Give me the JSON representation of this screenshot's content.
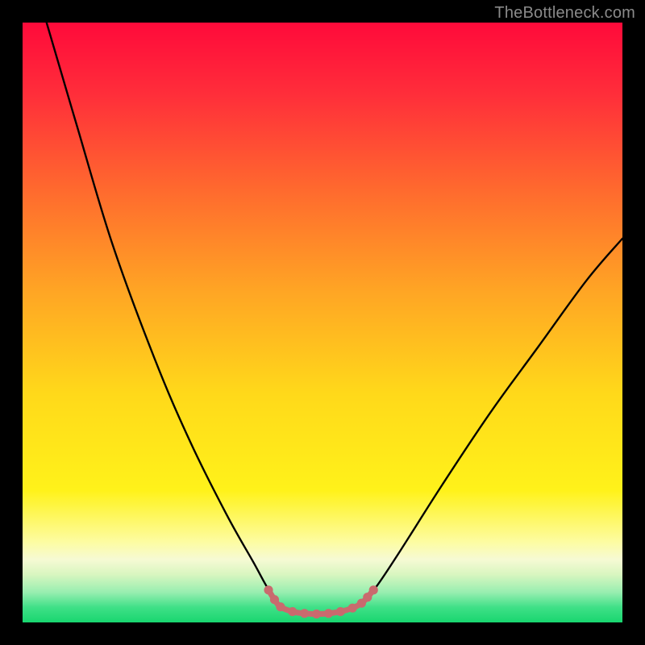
{
  "watermark": "TheBottleneck.com",
  "chart_data": {
    "type": "line",
    "title": "",
    "xlabel": "",
    "ylabel": "",
    "xlim": [
      0,
      100
    ],
    "ylim": [
      0,
      100
    ],
    "grid": false,
    "legend": false,
    "gradient_stops": [
      {
        "offset": 0.0,
        "color": "#ff0a3a"
      },
      {
        "offset": 0.12,
        "color": "#ff2e3a"
      },
      {
        "offset": 0.28,
        "color": "#ff6a2e"
      },
      {
        "offset": 0.45,
        "color": "#ffa624"
      },
      {
        "offset": 0.62,
        "color": "#ffd91a"
      },
      {
        "offset": 0.78,
        "color": "#fff21a"
      },
      {
        "offset": 0.865,
        "color": "#fdfca0"
      },
      {
        "offset": 0.895,
        "color": "#f6fad4"
      },
      {
        "offset": 0.92,
        "color": "#d9f6c0"
      },
      {
        "offset": 0.95,
        "color": "#97eeb0"
      },
      {
        "offset": 0.975,
        "color": "#3fe087"
      },
      {
        "offset": 1.0,
        "color": "#18d66f"
      }
    ],
    "series": [
      {
        "name": "bottleneck-curve",
        "stroke": "#000000",
        "stroke_width": 2.2,
        "points": [
          {
            "x": 4.0,
            "y": 100.0
          },
          {
            "x": 9.0,
            "y": 83.0
          },
          {
            "x": 15.0,
            "y": 63.0
          },
          {
            "x": 22.0,
            "y": 44.0
          },
          {
            "x": 28.0,
            "y": 30.0
          },
          {
            "x": 34.0,
            "y": 18.0
          },
          {
            "x": 38.5,
            "y": 10.0
          },
          {
            "x": 41.0,
            "y": 5.5
          },
          {
            "x": 43.0,
            "y": 3.0
          },
          {
            "x": 46.0,
            "y": 1.6
          },
          {
            "x": 50.0,
            "y": 1.4
          },
          {
            "x": 54.0,
            "y": 1.8
          },
          {
            "x": 56.5,
            "y": 3.2
          },
          {
            "x": 59.0,
            "y": 6.0
          },
          {
            "x": 63.0,
            "y": 12.0
          },
          {
            "x": 70.0,
            "y": 23.0
          },
          {
            "x": 78.0,
            "y": 35.0
          },
          {
            "x": 86.0,
            "y": 46.0
          },
          {
            "x": 94.0,
            "y": 57.0
          },
          {
            "x": 100.0,
            "y": 64.0
          }
        ]
      },
      {
        "name": "bottom-markers",
        "stroke": "#c96a6e",
        "stroke_width": 7,
        "marker_radius": 5.5,
        "points": [
          {
            "x": 41.0,
            "y": 5.4
          },
          {
            "x": 42.0,
            "y": 3.8
          },
          {
            "x": 43.0,
            "y": 2.6
          },
          {
            "x": 45.0,
            "y": 1.8
          },
          {
            "x": 47.0,
            "y": 1.5
          },
          {
            "x": 49.0,
            "y": 1.4
          },
          {
            "x": 51.0,
            "y": 1.5
          },
          {
            "x": 53.0,
            "y": 1.8
          },
          {
            "x": 55.0,
            "y": 2.4
          },
          {
            "x": 56.5,
            "y": 3.2
          },
          {
            "x": 57.5,
            "y": 4.2
          },
          {
            "x": 58.5,
            "y": 5.4
          }
        ]
      }
    ]
  }
}
